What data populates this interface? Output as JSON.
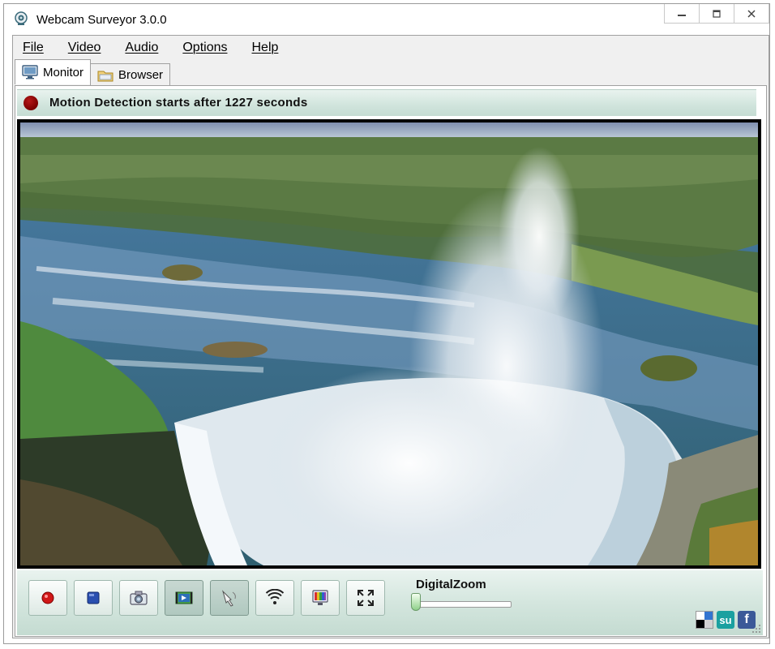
{
  "window": {
    "title": "Webcam Surveyor 3.0.0"
  },
  "menu": {
    "items": [
      {
        "label": "File"
      },
      {
        "label": "Video"
      },
      {
        "label": "Audio"
      },
      {
        "label": "Options"
      },
      {
        "label": "Help"
      }
    ]
  },
  "tabs": [
    {
      "label": "Monitor",
      "active": true,
      "icon": "monitor-icon"
    },
    {
      "label": "Browser",
      "active": false,
      "icon": "folder-icon"
    }
  ],
  "status": {
    "text": "Motion Detection starts after 1227 seconds",
    "indicator_color": "#8b0000"
  },
  "video": {
    "content": "waterfall-aerial-view"
  },
  "controls": {
    "buttons": [
      {
        "icon": "record-icon"
      },
      {
        "icon": "stop-icon"
      },
      {
        "icon": "snapshot-camera-icon"
      },
      {
        "icon": "video-capture-icon",
        "pressed": true
      },
      {
        "icon": "motion-detect-icon",
        "pressed": true
      },
      {
        "icon": "broadcast-icon"
      },
      {
        "icon": "video-settings-icon"
      },
      {
        "icon": "fullscreen-icon"
      }
    ],
    "zoom_label": "DigitalZoom",
    "zoom_level": 0
  },
  "social": [
    {
      "icon": "delicious-icon"
    },
    {
      "icon": "stumbleupon-icon",
      "text": "su"
    },
    {
      "icon": "facebook-icon",
      "text": "f"
    }
  ],
  "colors": {
    "accent_strip": "#d0e4dc",
    "record_red": "#d01818",
    "stop_blue": "#2a4fb0",
    "facebook_blue": "#3b5998",
    "stumble_teal": "#1aa0a0"
  }
}
